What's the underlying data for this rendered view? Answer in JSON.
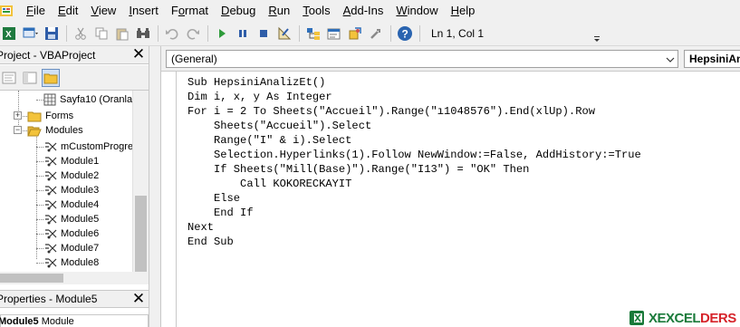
{
  "menu": {
    "items": [
      {
        "label": "File",
        "ul": "F"
      },
      {
        "label": "Edit",
        "ul": "E"
      },
      {
        "label": "View",
        "ul": "V"
      },
      {
        "label": "Insert",
        "ul": "I"
      },
      {
        "label": "Format",
        "ul": "o"
      },
      {
        "label": "Debug",
        "ul": "D"
      },
      {
        "label": "Run",
        "ul": "R"
      },
      {
        "label": "Tools",
        "ul": "T"
      },
      {
        "label": "Add-Ins",
        "ul": "A"
      },
      {
        "label": "Window",
        "ul": "W"
      },
      {
        "label": "Help",
        "ul": "H"
      }
    ]
  },
  "toolbar": {
    "cursor_position": "Ln 1, Col 1"
  },
  "project_panel": {
    "title": "Project - VBAProject",
    "close_glyph": "✕",
    "tree": {
      "sheet_item": "Sayfa10 (Oranla",
      "forms_folder": "Forms",
      "modules_folder": "Modules",
      "modules": [
        "mCustomProgres",
        "Module1",
        "Module2",
        "Module3",
        "Module4",
        "Module5",
        "Module6",
        "Module7",
        "Module8"
      ]
    }
  },
  "properties_panel": {
    "title": "Properties - Module5",
    "close_glyph": "✕",
    "object_name": "Module5",
    "object_type": "Module"
  },
  "code_window": {
    "object_combo": "(General)",
    "procedure_combo": "HepsiniAnalizEt",
    "lines": [
      "Sub HepsiniAnalizEt()",
      "Dim i, x, y As Integer",
      "For i = 2 To Sheets(\"Accueil\").Range(\"ı1048576\").End(xlUp).Row",
      "    Sheets(\"Accueil\").Select",
      "    Range(\"I\" & i).Select",
      "    Selection.Hyperlinks(1).Follow NewWindow:=False, AddHistory:=True",
      "    If Sheets(\"Mill(Base)\").Range(\"I13\") = \"OK\" Then",
      "        Call KOKORECKAYIT",
      "    Else",
      "    End If",
      "Next",
      "End Sub"
    ]
  },
  "watermark": {
    "text_a": "X",
    "text_b": "EXCEL",
    "text_c": "DERS"
  },
  "colors": {
    "accent_blue": "#2f6fba",
    "run_green": "#2e9b3a",
    "help_blue": "#2a64b0",
    "watermark_green": "#1a7a3a",
    "watermark_red": "#d6232a"
  }
}
